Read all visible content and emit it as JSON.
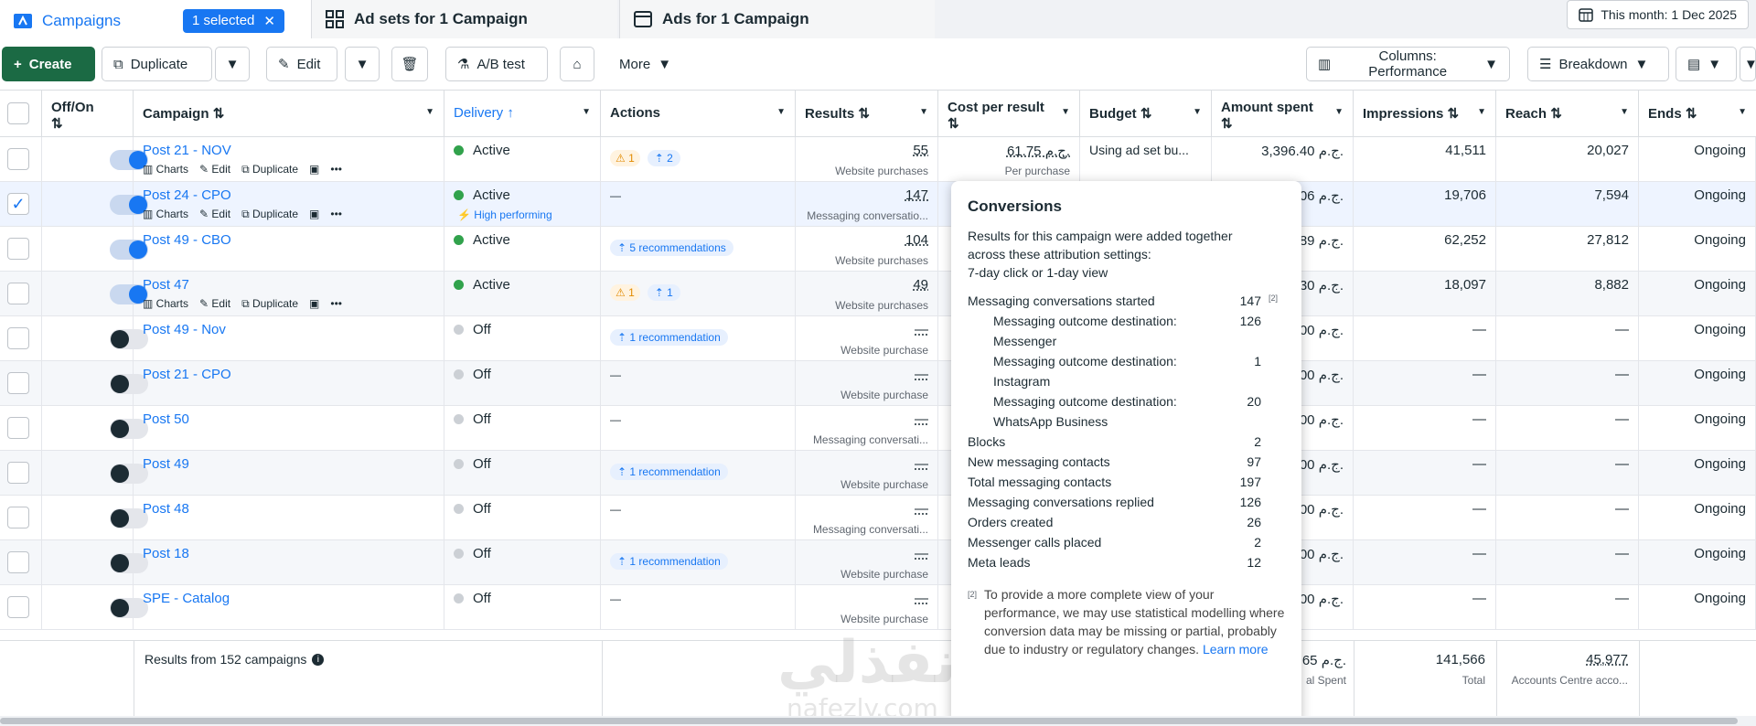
{
  "tabs": {
    "campaigns": "Campaigns",
    "selected": "1 selected",
    "adsets": "Ad sets for 1 Campaign",
    "ads": "Ads for 1 Campaign",
    "date": "This month: 1 Dec 2025"
  },
  "toolbar": {
    "create": "Create",
    "duplicate": "Duplicate",
    "edit": "Edit",
    "abtest": "A/B test",
    "more": "More",
    "columns": "Columns: Performance",
    "breakdown": "Breakdown"
  },
  "headers": {
    "offon": "Off/On",
    "campaign": "Campaign",
    "delivery": "Delivery",
    "actions": "Actions",
    "results": "Results",
    "cpr": "Cost per result",
    "budget": "Budget",
    "spent": "Amount spent",
    "impressions": "Impressions",
    "reach": "Reach",
    "ends": "Ends"
  },
  "subactions": {
    "charts": "Charts",
    "edit": "Edit",
    "duplicate": "Duplicate"
  },
  "rows": [
    {
      "name": "Post 21 - NOV",
      "delivery": "Active",
      "actions": [
        "1",
        "2"
      ],
      "results": "55",
      "results_sub": "Website purchases",
      "cpr": "61.75 ج.م.",
      "cpr_sub": "Per purchase",
      "budget": "Using ad set bu...",
      "spent": "3,396.40 ج.م.",
      "impressions": "41,511",
      "reach": "20,027",
      "ends": "Ongoing"
    },
    {
      "name": "Post 24 - CPO",
      "delivery": "Active",
      "high": "High performing",
      "actions_text": "—",
      "results": "147",
      "results_sub": "Messaging conversatio...",
      "spent": "06 ج.م.",
      "impressions": "19,706",
      "reach": "7,594",
      "ends": "Ongoing"
    },
    {
      "name": "Post 49 - CBO",
      "delivery": "Active",
      "recs": "5 recommendations",
      "results": "104",
      "results_sub": "Website purchases",
      "spent": "89 ج.م.",
      "impressions": "62,252",
      "reach": "27,812",
      "ends": "Ongoing"
    },
    {
      "name": "Post 47",
      "delivery": "Active",
      "actions": [
        "1",
        "1"
      ],
      "results": "49",
      "results_sub": "Website purchases",
      "spent": "30 ج.م.",
      "impressions": "18,097",
      "reach": "8,882",
      "ends": "Ongoing"
    },
    {
      "name": "Post 49 - Nov",
      "delivery": "Off",
      "recs": "1 recommendation",
      "results": "—",
      "results_sub": "Website purchase",
      "spent": "00 ج.م.",
      "impressions": "—",
      "reach": "—",
      "ends": "Ongoing"
    },
    {
      "name": "Post 21 - CPO",
      "delivery": "Off",
      "actions_text": "—",
      "results": "—",
      "results_sub": "Website purchase",
      "spent": "00 ج.م.",
      "impressions": "—",
      "reach": "—",
      "ends": "Ongoing"
    },
    {
      "name": "Post 50",
      "delivery": "Off",
      "actions_text": "—",
      "results": "—",
      "results_sub": "Messaging conversati...",
      "spent": "00 ج.م.",
      "impressions": "—",
      "reach": "—",
      "ends": "Ongoing"
    },
    {
      "name": "Post 49",
      "delivery": "Off",
      "recs": "1 recommendation",
      "results": "—",
      "results_sub": "Website purchase",
      "spent": "00 ج.م.",
      "impressions": "—",
      "reach": "—",
      "ends": "Ongoing"
    },
    {
      "name": "Post 48",
      "delivery": "Off",
      "actions_text": "—",
      "results": "—",
      "results_sub": "Messaging conversati...",
      "spent": "00 ج.م.",
      "impressions": "—",
      "reach": "—",
      "ends": "Ongoing"
    },
    {
      "name": "Post 18",
      "delivery": "Off",
      "recs": "1 recommendation",
      "results": "—",
      "results_sub": "Website purchase",
      "spent": "00 ج.م.",
      "impressions": "—",
      "reach": "—",
      "ends": "Ongoing"
    },
    {
      "name": "SPE - Catalog",
      "delivery": "Off",
      "actions_text": "—",
      "results": "—",
      "results_sub": "Website purchase",
      "spent": "00 ج.م.",
      "impressions": "—",
      "reach": "—",
      "ends": "Ongoing"
    }
  ],
  "footer": {
    "results_from": "Results from 152 campaigns",
    "spent": "65 ج.م.",
    "spent_sub": "al Spent",
    "impressions": "141,566",
    "impressions_sub": "Total",
    "reach": "45,977",
    "reach_sub": "Accounts Centre acco..."
  },
  "popup": {
    "title": "Conversions",
    "desc1": "Results for this campaign were added together",
    "desc2": "across these attribution settings:",
    "desc3": "7-day click or 1-day view",
    "items": [
      {
        "label": "Messaging conversations started",
        "value": "147",
        "note": "[2]"
      },
      {
        "label": "Messaging outcome destination:",
        "label2": "Messenger",
        "value": "126"
      },
      {
        "label": "Messaging outcome destination:",
        "label2": "Instagram",
        "value": "1"
      },
      {
        "label": "Messaging outcome destination:",
        "label2": "WhatsApp Business",
        "value": "20"
      },
      {
        "label": "Blocks",
        "value": "2"
      },
      {
        "label": "New messaging contacts",
        "value": "97"
      },
      {
        "label": "Total messaging contacts",
        "value": "197"
      },
      {
        "label": "Messaging conversations replied",
        "value": "126"
      },
      {
        "label": "Orders created",
        "value": "26"
      },
      {
        "label": "Messenger calls placed",
        "value": "2"
      },
      {
        "label": "Meta leads",
        "value": "12"
      }
    ],
    "footnote_mark": "[2]",
    "footnote": "To provide a more complete view of your performance, we may use statistical modelling where conversion data may be missing or partial, probably due to industry or regulatory changes.",
    "learn_more": "Learn more"
  },
  "watermark": {
    "ar": "نفذلي",
    "en": "nafezly.com"
  }
}
